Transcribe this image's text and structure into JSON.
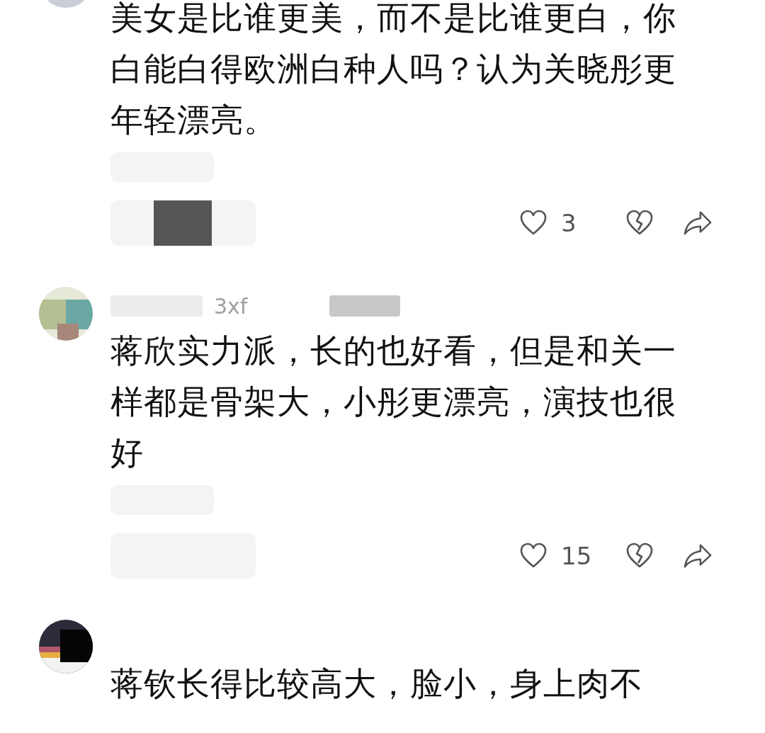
{
  "comments": [
    {
      "text": "美女是比谁更美，而不是比谁更白，你白能白得欧洲白种人吗？认为关晓彤更年轻漂亮。",
      "likes": "3"
    },
    {
      "username": "3xf",
      "text": "蒋欣实力派，长的也好看，但是和关一样都是骨架大，小彤更漂亮，演技也很好",
      "likes": "15"
    },
    {
      "text": "蒋钦长得比较高大，脸小，身上肉不"
    }
  ]
}
